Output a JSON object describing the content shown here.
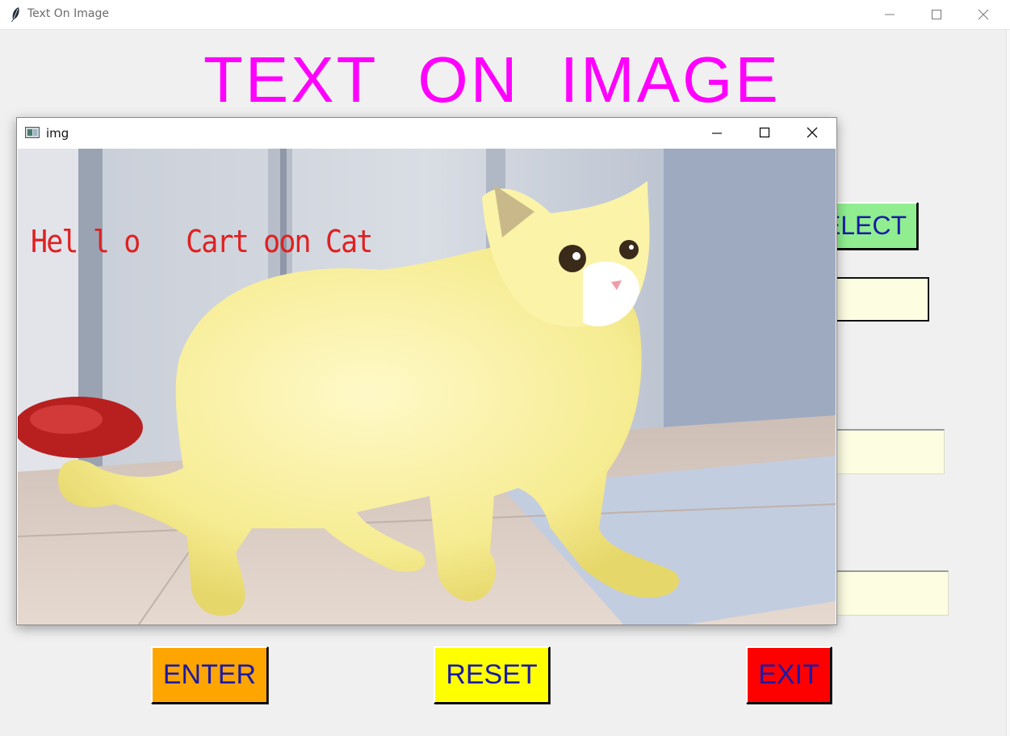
{
  "window": {
    "title": "Text On Image"
  },
  "heading": "TEXT  ON  IMAGE",
  "buttons": {
    "select": "ELECT",
    "enter": "ENTER",
    "reset": "RESET",
    "exit": "EXIT"
  },
  "image_window": {
    "title": "img",
    "overlay_text": "Hel l o   Cart oon Cat"
  },
  "colors": {
    "heading": "#ff00ff",
    "select_bg": "#90ee90",
    "enter_bg": "#ffa500",
    "reset_bg": "#ffff00",
    "exit_bg": "#ff0000",
    "button_text": "#1a1aa8",
    "field_bg": "#fdfde2",
    "overlay_text": "#e02020"
  },
  "icons": [
    "feather-icon",
    "minimize-icon",
    "maximize-icon",
    "close-icon",
    "image-window-icon"
  ]
}
